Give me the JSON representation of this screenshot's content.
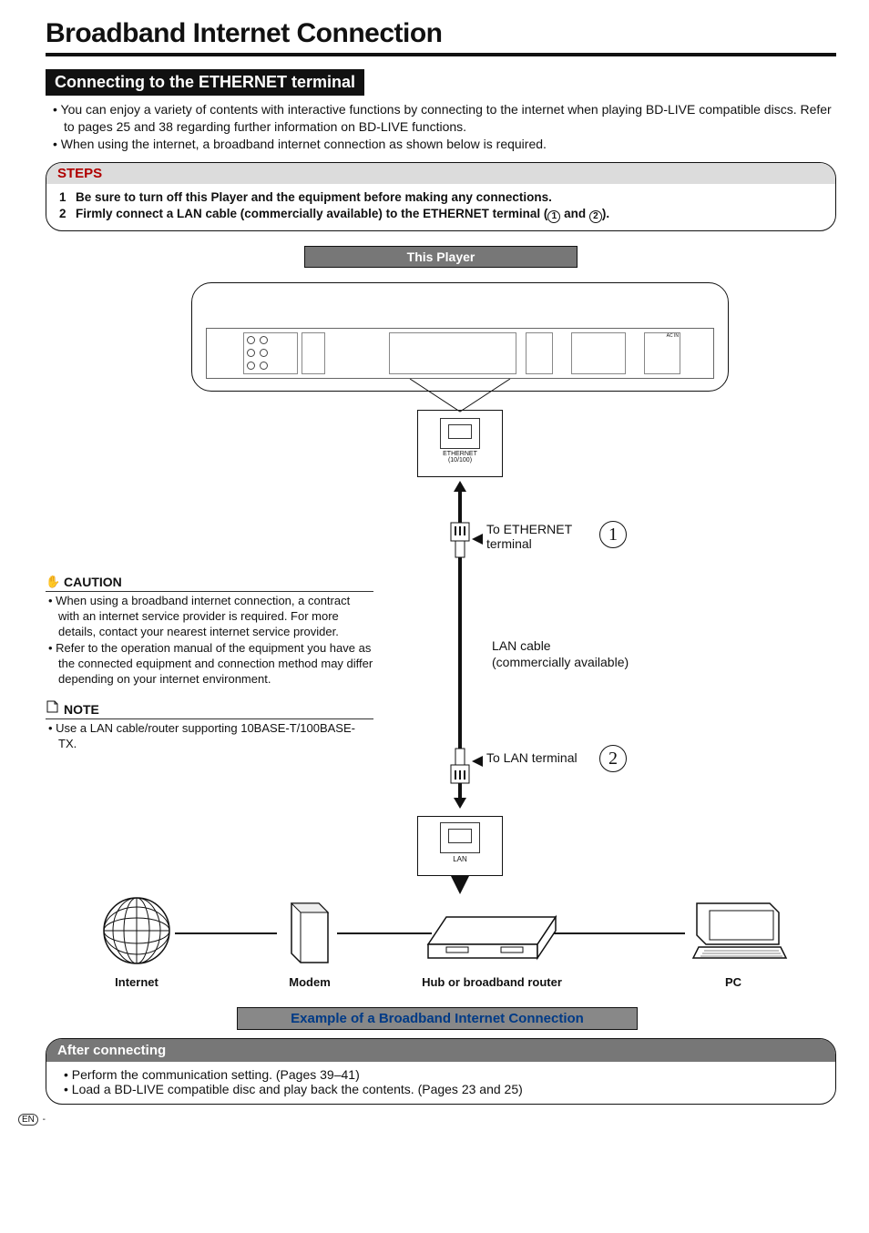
{
  "title": "Broadband Internet Connection",
  "section_title": "Connecting to the ETHERNET terminal",
  "intro_bullets": [
    "You can enjoy a variety of contents with interactive functions by connecting to the internet when playing BD-LIVE compatible discs. Refer to pages 25 and 38 regarding further information on BD-LIVE functions.",
    "When using the internet, a broadband internet connection as shown below is required."
  ],
  "steps": {
    "heading": "STEPS",
    "items": [
      {
        "num": "1",
        "text_a": "Be sure to turn off this Player and the equipment before making any connections."
      },
      {
        "num": "2",
        "text_a": "Firmly connect a LAN cable (commercially available) to the ETHERNET terminal (",
        "circ1": "1",
        "mid": " and ",
        "circ2": "2",
        "text_b": ")."
      }
    ]
  },
  "diagram": {
    "player_label": "This Player",
    "acin_label": "AC IN",
    "eth_callout": {
      "top": "ETHERNET",
      "bottom": "(10/100)"
    },
    "to_eth": "To ETHERNET terminal",
    "to_lan": "To LAN terminal",
    "circle1": "1",
    "circle2": "2",
    "mid_text": {
      "line1": "LAN cable",
      "line2": "(commercially available)"
    },
    "lan_box_label": "LAN",
    "devices": {
      "internet": "Internet",
      "modem": "Modem",
      "router": "Hub or broadband router",
      "pc": "PC"
    },
    "example_bar": "Example of a Broadband Internet Connection"
  },
  "caution": {
    "heading": "CAUTION",
    "bullets": [
      "When using a broadband internet connection, a contract with an internet service provider is required. For more details, contact your nearest internet service provider.",
      "Refer to the operation manual of the equipment you have as the connected equipment and connection method may differ depending on your internet environment."
    ]
  },
  "note": {
    "heading": "NOTE",
    "bullets": [
      "Use a LAN cable/router supporting 10BASE-T/100BASE-TX."
    ]
  },
  "after": {
    "heading": "After connecting",
    "bullets": [
      "Perform the communication setting. (Pages 39–41)",
      "Load a BD-LIVE compatible disc and play back the contents. (Pages 23 and 25)"
    ]
  },
  "footer": {
    "lang": "EN",
    "dash": " -"
  }
}
